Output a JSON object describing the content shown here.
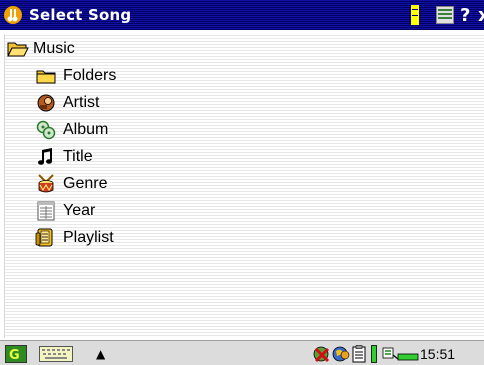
{
  "window": {
    "title": "Select Song",
    "help_glyph": "?",
    "close_glyph": "x"
  },
  "tree": {
    "root": {
      "label": "Music",
      "icon": "folder-open-icon"
    },
    "items": [
      {
        "label": "Folders",
        "icon": "folder-icon"
      },
      {
        "label": "Artist",
        "icon": "artist-icon"
      },
      {
        "label": "Album",
        "icon": "album-icon"
      },
      {
        "label": "Title",
        "icon": "music-note-icon"
      },
      {
        "label": "Genre",
        "icon": "genre-drum-icon"
      },
      {
        "label": "Year",
        "icon": "calendar-icon"
      },
      {
        "label": "Playlist",
        "icon": "playlist-icon"
      }
    ]
  },
  "statusbar": {
    "up_glyph": "▲",
    "time": "15:51"
  },
  "colors": {
    "titlebar": "#000066",
    "folder": "#f2c230",
    "battery": "#33cc33",
    "start_button": "#2e8b1f"
  }
}
